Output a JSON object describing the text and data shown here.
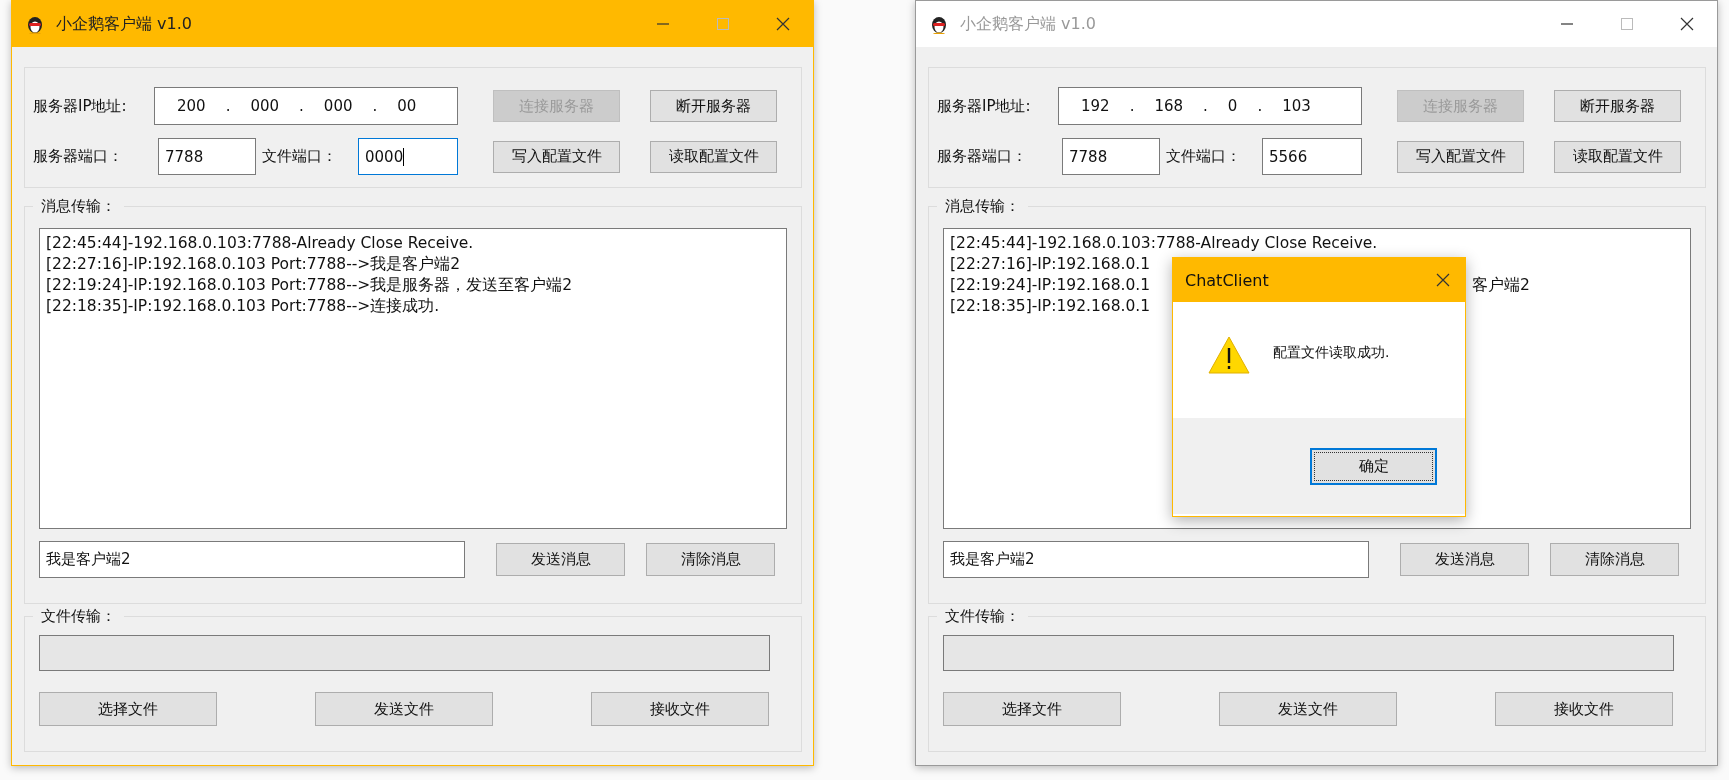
{
  "windows": [
    {
      "title": "小企鹅客户端 v1.0",
      "active": true,
      "ip_label": "服务器IP地址:",
      "ip_parts": [
        "200",
        ".",
        "000",
        ".",
        "000",
        ".",
        "00"
      ],
      "port_label": "服务器端口：",
      "port": "7788",
      "file_port_label": "文件端口：",
      "file_port": {
        "value": "0000",
        "focused": true
      },
      "server_buttons": [
        {
          "label": "连接服务器",
          "disabled": true
        },
        {
          "label": "断开服务器",
          "disabled": false
        },
        {
          "label": "写入配置文件",
          "disabled": false
        },
        {
          "label": "读取配置文件",
          "disabled": false
        }
      ],
      "message_group_label": "消息传输：",
      "log": [
        {
          "text": "[22:45:44]-192.168.0.103:7788-Already Close Receive."
        },
        {
          "text": "[22:27:16]-IP:192.168.0.103 Port:7788-->我是客户端2"
        },
        {
          "text": "[22:19:24]-IP:192.168.0.103 Port:7788-->我是服务器，发送至客户端2"
        },
        {
          "text": "[22:18:35]-IP:192.168.0.103 Port:7788-->连接成功."
        }
      ],
      "message_input": "我是客户端2",
      "send_button": "发送消息",
      "clear_button": "清除消息",
      "file_group_label": "文件传输：",
      "file_progress": {
        "level": 0
      },
      "file_buttons": [
        "选择文件",
        "发送文件",
        "接收文件"
      ]
    },
    {
      "title": "小企鹅客户端 v1.0",
      "active": false,
      "ip_label": "服务器IP地址:",
      "ip_parts": [
        "192",
        ".",
        "168",
        ".",
        "0",
        ".",
        "103"
      ],
      "port_label": "服务器端口：",
      "port": "7788",
      "file_port_label": "文件端口：",
      "file_port": {
        "value": "5566",
        "focused": false
      },
      "server_buttons": [
        {
          "label": "连接服务器",
          "disabled": true
        },
        {
          "label": "断开服务器",
          "disabled": false
        },
        {
          "label": "写入配置文件",
          "disabled": false
        },
        {
          "label": "读取配置文件",
          "disabled": false
        }
      ],
      "message_group_label": "消息传输：",
      "log": [
        {
          "text": "[22:45:44]-192.168.0.103:7788-Already Close Receive."
        },
        {
          "text": "[22:27:16]-IP:192.168.0.1"
        },
        {
          "text": "[22:19:24]-IP:192.168.0.1",
          "tail": "客户端2"
        },
        {
          "text": "[22:18:35]-IP:192.168.0.1"
        }
      ],
      "message_input": "我是客户端2",
      "send_button": "发送消息",
      "clear_button": "清除消息",
      "file_group_label": "文件传输：",
      "file_progress": {
        "level": 0
      },
      "file_buttons": [
        "选择文件",
        "发送文件",
        "接收文件"
      ],
      "dialog": {
        "title": "ChatClient",
        "message": "配置文件读取成功.",
        "ok_button": {
          "label": "确定",
          "focused": true
        }
      }
    }
  ]
}
